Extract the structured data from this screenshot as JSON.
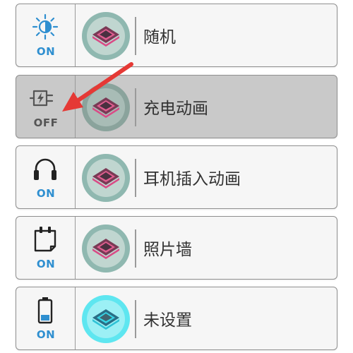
{
  "items": [
    {
      "label": "随机",
      "status": "ON",
      "icon": "brightness-icon",
      "enabled": true
    },
    {
      "label": "充电动画",
      "status": "OFF",
      "icon": "charging-plug-icon",
      "enabled": false
    },
    {
      "label": "耳机插入动画",
      "status": "ON",
      "icon": "headphones-icon",
      "enabled": true
    },
    {
      "label": "照片墙",
      "status": "ON",
      "icon": "photo-note-icon",
      "enabled": true
    },
    {
      "label": "未设置",
      "status": "ON",
      "icon": "battery-icon",
      "enabled": true
    }
  ],
  "colors": {
    "on_blue": "#2f8fd0",
    "off_gray": "#555555",
    "pink_accent": "#d94b86",
    "cyan_accent": "#37d6e6",
    "arrow_red": "#e53935"
  }
}
